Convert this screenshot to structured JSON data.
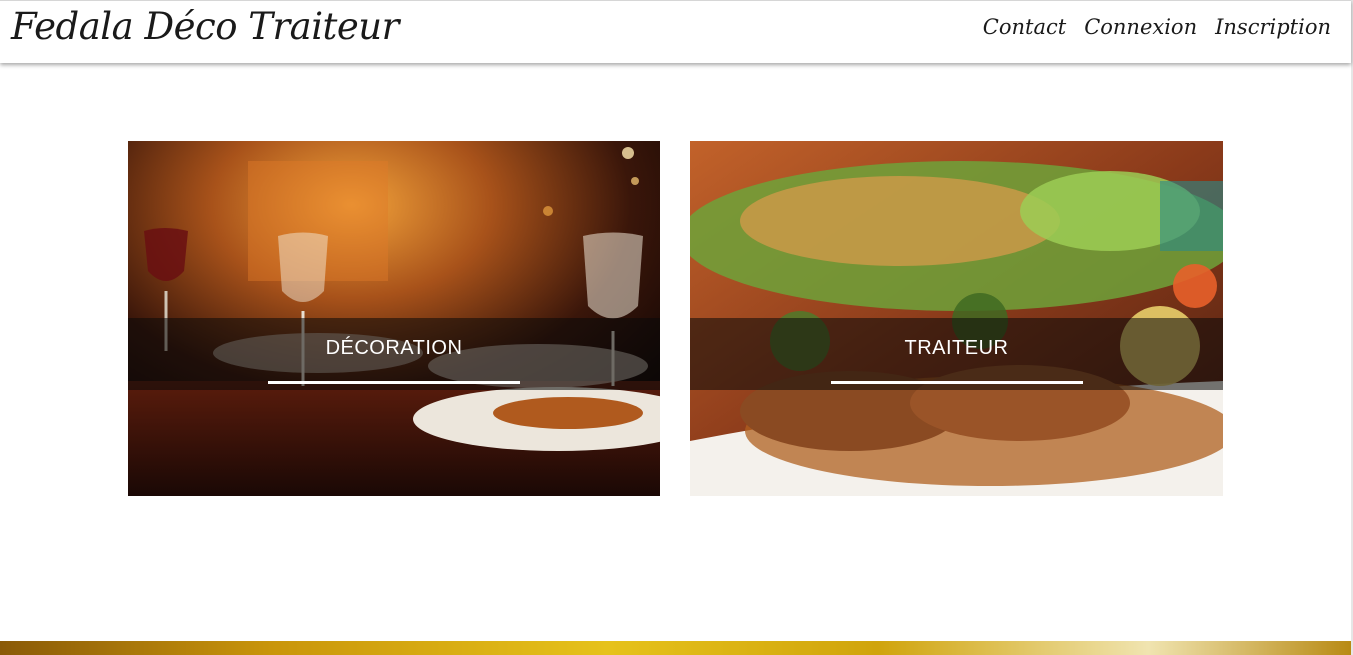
{
  "header": {
    "brand": "Fedala Déco Traiteur",
    "nav": [
      {
        "label": "Contact"
      },
      {
        "label": "Connexion"
      },
      {
        "label": "Inscription"
      }
    ]
  },
  "cards": [
    {
      "title": "DÉCORATION"
    },
    {
      "title": "TRAITEUR"
    }
  ]
}
